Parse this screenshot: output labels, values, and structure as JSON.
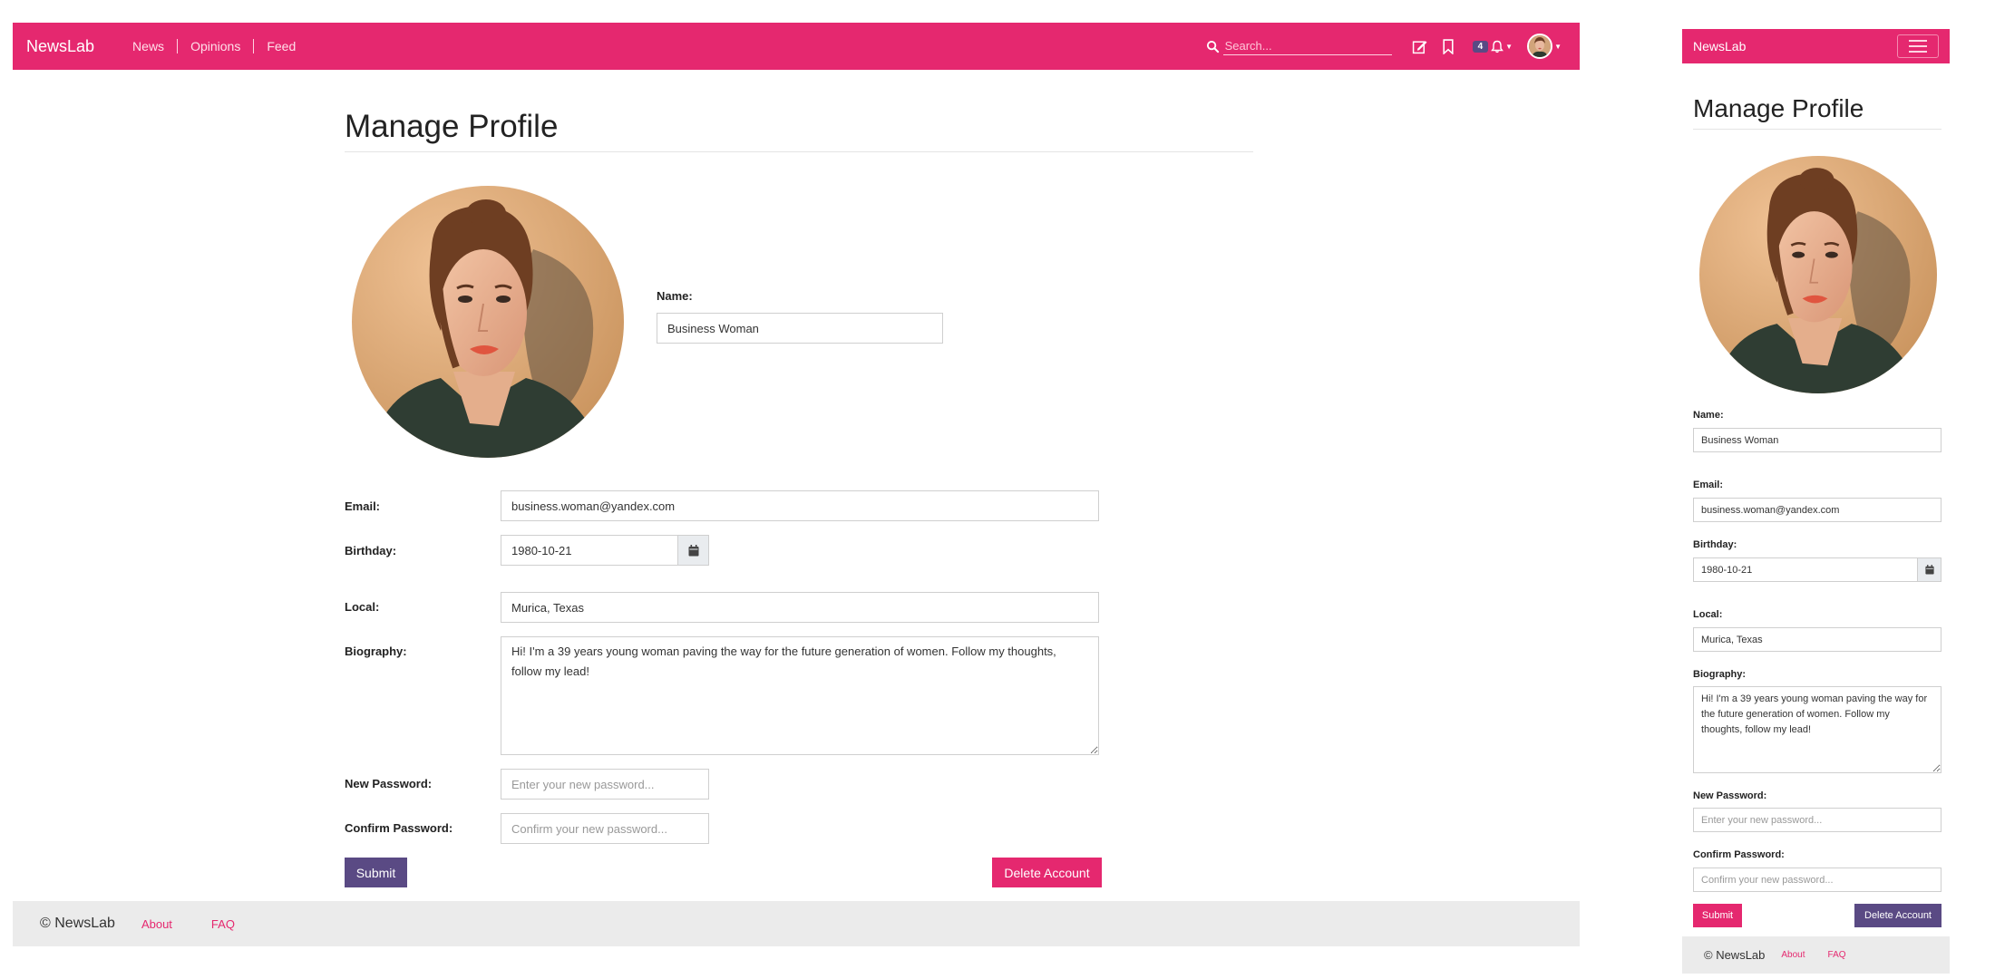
{
  "brand": "NewsLab",
  "nav": {
    "links": [
      "News",
      "Opinions",
      "Feed"
    ],
    "search_placeholder": "Search...",
    "notifications_count": "4"
  },
  "page": {
    "title": "Manage Profile",
    "labels": {
      "name": "Name:",
      "email": "Email:",
      "birthday": "Birthday:",
      "local": "Local:",
      "biography": "Biography:",
      "new_password": "New Password:",
      "confirm_password": "Confirm Password:"
    },
    "values": {
      "name": "Business Woman",
      "email": "business.woman@yandex.com",
      "birthday": "1980-10-21",
      "local": "Murica, Texas",
      "biography": "Hi! I'm a 39 years young woman paving the way for the future generation of women. Follow my thoughts, follow my lead!"
    },
    "placeholders": {
      "new_password": "Enter your new password...",
      "confirm_password": "Confirm your new password..."
    },
    "buttons": {
      "submit": "Submit",
      "delete": "Delete Account"
    }
  },
  "footer": {
    "copyright": "© NewsLab",
    "links": [
      "About",
      "FAQ"
    ]
  },
  "colors": {
    "brand_pink": "#e5286f",
    "accent_purple": "#5a4a84",
    "footer_gray": "#ebebeb"
  },
  "icons": [
    "search-icon",
    "edit-icon",
    "bookmark-icon",
    "bell-icon",
    "calendar-icon",
    "menu-icon"
  ]
}
